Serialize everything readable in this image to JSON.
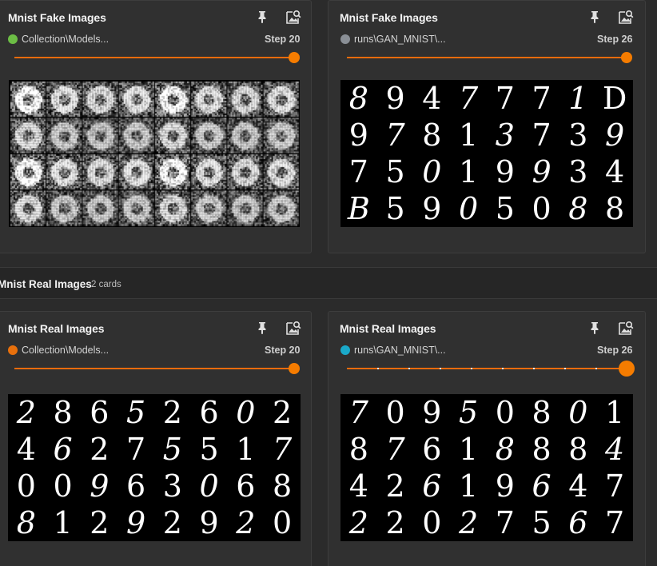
{
  "colors": {
    "accent": "#f57c00",
    "run_green": "#6cbd45",
    "run_gray": "#8a8f96",
    "run_orange": "#e8700c",
    "run_cyan": "#1aa9c9"
  },
  "cards": [
    {
      "title": "Mnist Fake Images",
      "run": "Collection\\Models...",
      "run_color": "#6cbd45",
      "step": "Step 20",
      "image": "noisy generated digit grid"
    },
    {
      "title": "Mnist Fake Images",
      "run": "runs\\GAN_MNIST\\...",
      "run_color": "#8a8f96",
      "step": "Step 26",
      "image": "generated digit grid",
      "digits": [
        "8",
        "9",
        "4",
        "7",
        "7",
        "7",
        "1",
        "D",
        "9",
        "7",
        "8",
        "1",
        "3",
        "7",
        "3",
        "9",
        "7",
        "5",
        "0",
        "1",
        "9",
        "9",
        "3",
        "4",
        "B",
        "5",
        "9",
        "0",
        "5",
        "0",
        "8",
        "8"
      ]
    },
    {
      "title": "Mnist Real Images",
      "run": "Collection\\Models...",
      "run_color": "#e8700c",
      "step": "Step 20",
      "image": "real digit grid",
      "digits": [
        "2",
        "8",
        "6",
        "5",
        "2",
        "6",
        "0",
        "2",
        "4",
        "6",
        "2",
        "7",
        "5",
        "5",
        "1",
        "7",
        "0",
        "0",
        "9",
        "6",
        "3",
        "0",
        "6",
        "8",
        "8",
        "1",
        "2",
        "9",
        "2",
        "9",
        "2",
        "0"
      ]
    },
    {
      "title": "Mnist Real Images",
      "run": "runs\\GAN_MNIST\\...",
      "run_color": "#1aa9c9",
      "step": "Step 26",
      "image": "real digit grid",
      "digits": [
        "7",
        "0",
        "9",
        "5",
        "0",
        "8",
        "0",
        "1",
        "8",
        "7",
        "6",
        "1",
        "8",
        "8",
        "8",
        "4",
        "4",
        "2",
        "6",
        "1",
        "9",
        "6",
        "4",
        "7",
        "2",
        "2",
        "0",
        "2",
        "7",
        "5",
        "6",
        "7"
      ]
    }
  ],
  "group": {
    "title": "Mnist Real Images",
    "count": "2 cards"
  },
  "icons": {
    "pin": "pin-icon",
    "image_search": "image-search-icon"
  }
}
